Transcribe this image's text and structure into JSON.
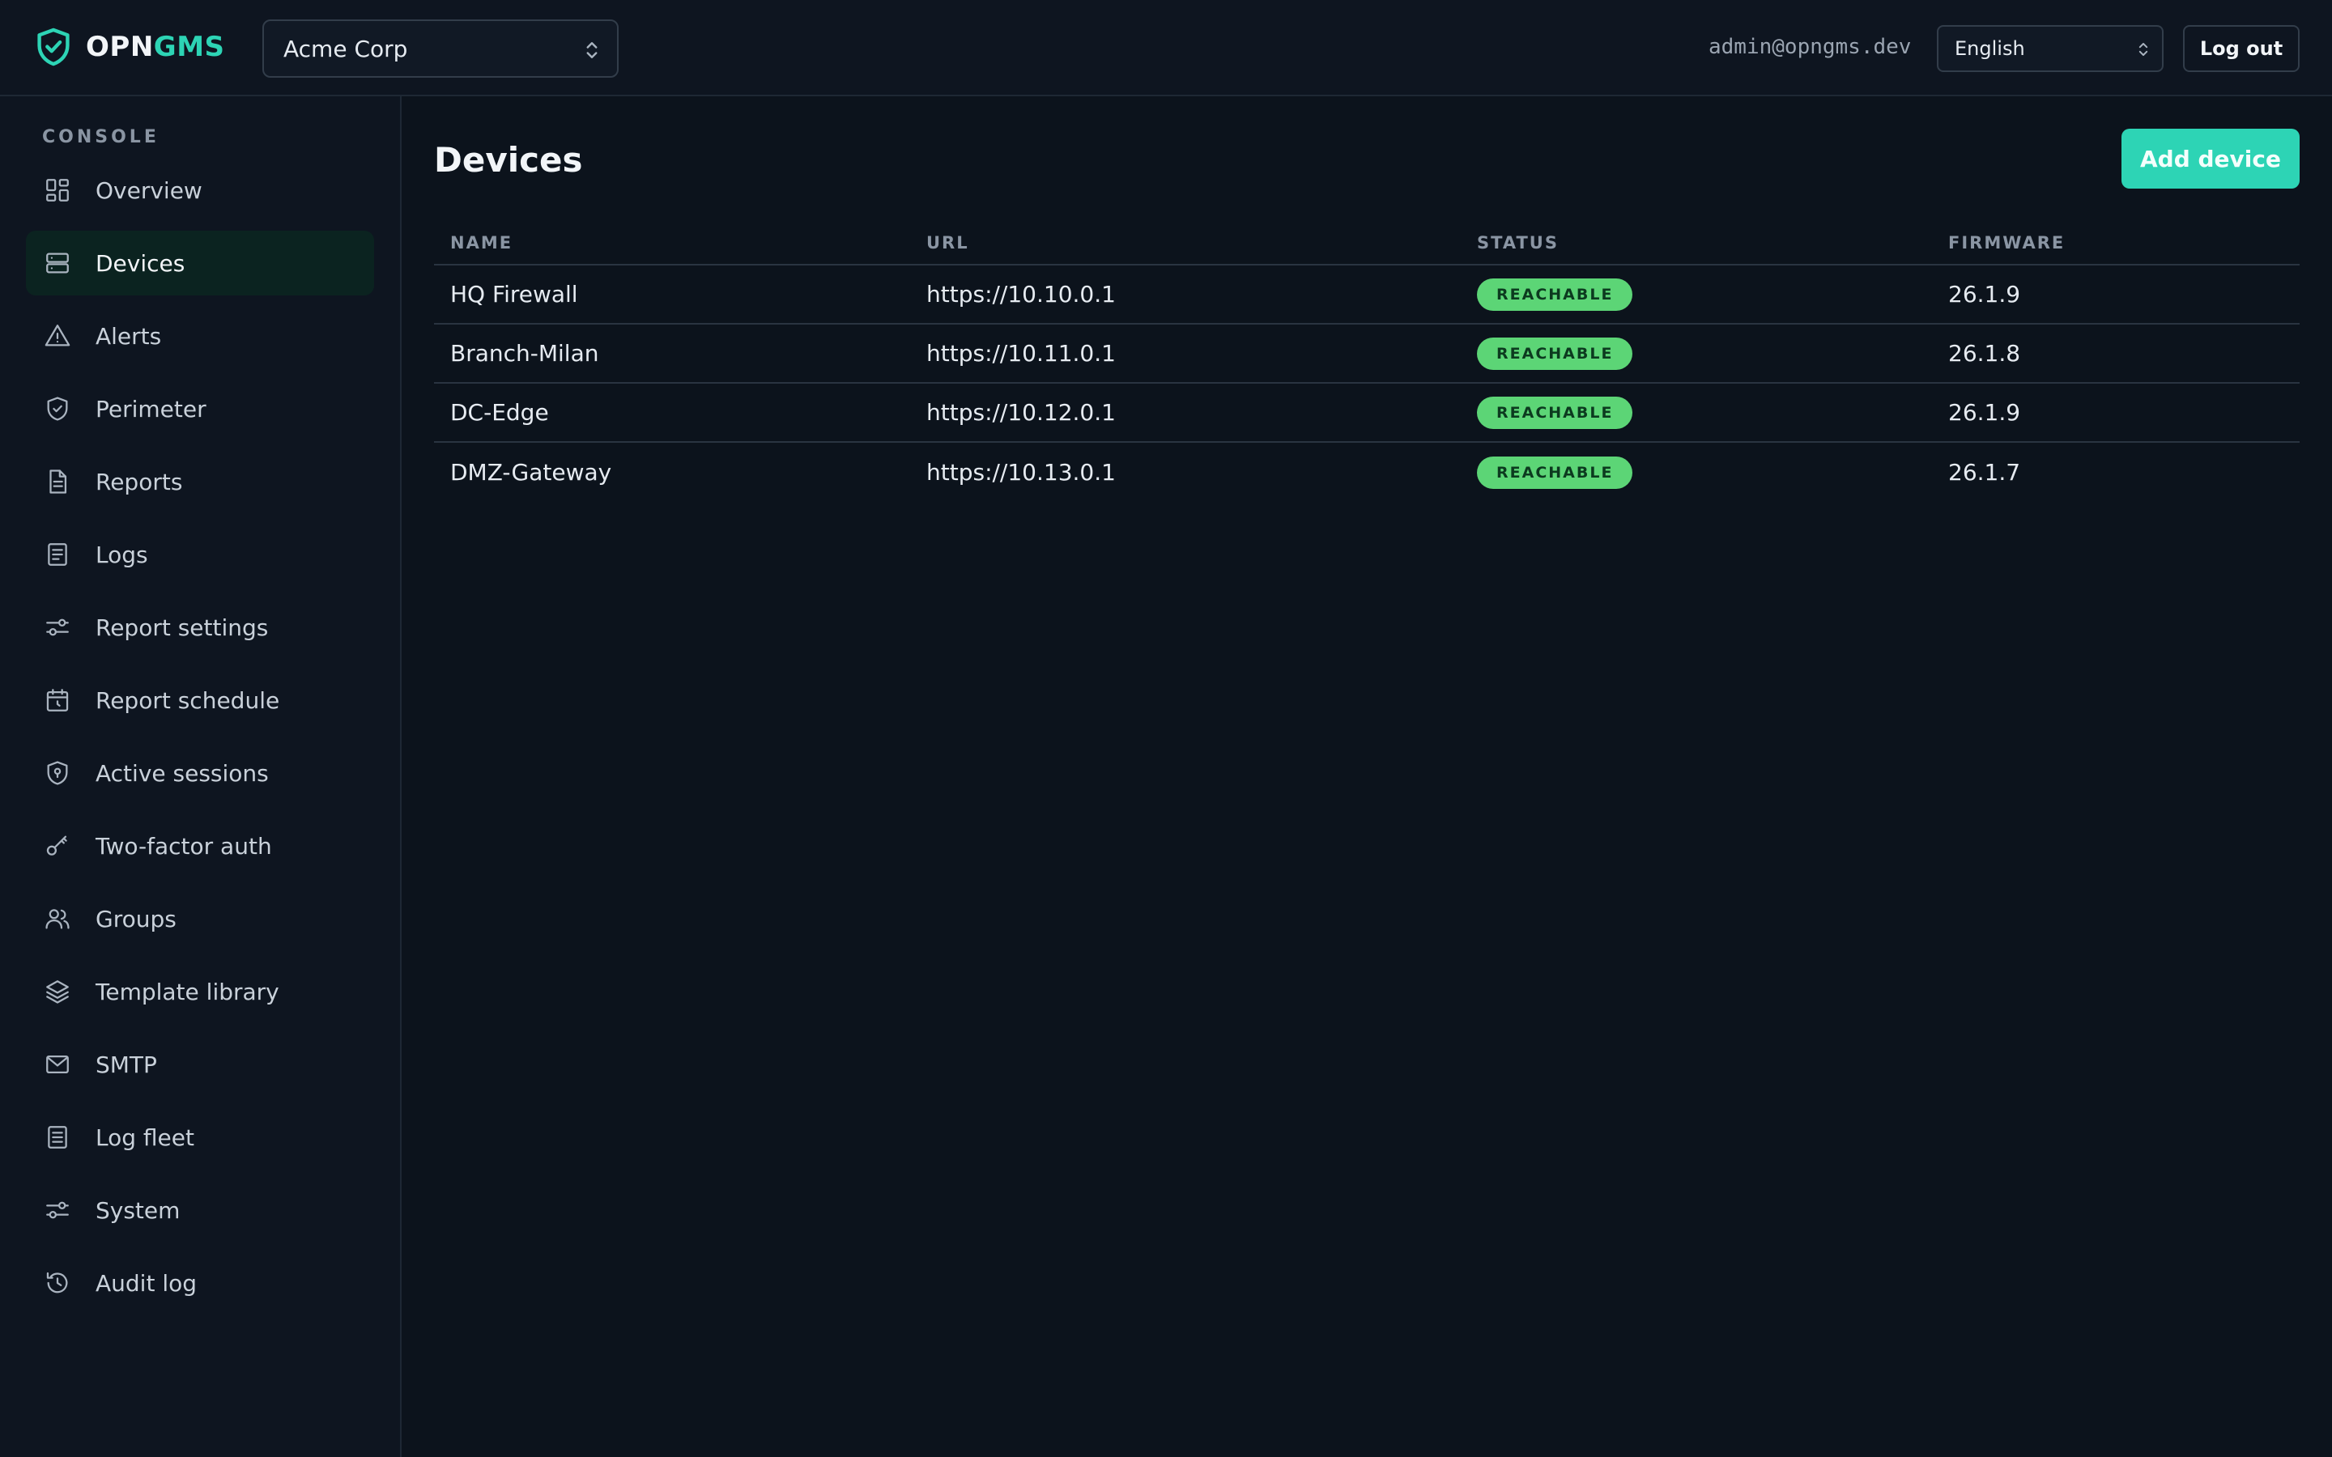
{
  "brand": {
    "name_a": "OPN",
    "name_b": "GMS"
  },
  "header": {
    "org_selected": "Acme Corp",
    "user_email": "admin@opngms.dev",
    "language_selected": "English",
    "logout_label": "Log out"
  },
  "sidebar": {
    "section_label": "CONSOLE",
    "items": [
      {
        "label": "Overview",
        "icon": "grid-icon"
      },
      {
        "label": "Devices",
        "icon": "server-icon",
        "active": true
      },
      {
        "label": "Alerts",
        "icon": "alert-triangle-icon"
      },
      {
        "label": "Perimeter",
        "icon": "shield-check-icon"
      },
      {
        "label": "Reports",
        "icon": "file-text-icon"
      },
      {
        "label": "Logs",
        "icon": "file-lines-icon"
      },
      {
        "label": "Report settings",
        "icon": "sliders-icon"
      },
      {
        "label": "Report schedule",
        "icon": "calendar-clock-icon"
      },
      {
        "label": "Active sessions",
        "icon": "shield-pin-icon"
      },
      {
        "label": "Two-factor auth",
        "icon": "key-icon"
      },
      {
        "label": "Groups",
        "icon": "users-icon"
      },
      {
        "label": "Template library",
        "icon": "layers-icon"
      },
      {
        "label": "SMTP",
        "icon": "mail-icon"
      },
      {
        "label": "Log fleet",
        "icon": "file-list-icon"
      },
      {
        "label": "System",
        "icon": "sliders-icon"
      },
      {
        "label": "Audit log",
        "icon": "history-icon"
      }
    ]
  },
  "main": {
    "title": "Devices",
    "add_label": "Add device",
    "columns": [
      "NAME",
      "URL",
      "STATUS",
      "FIRMWARE"
    ],
    "rows": [
      {
        "name": "HQ Firewall",
        "url": "https://10.10.0.1",
        "status": "REACHABLE",
        "firmware": "26.1.9"
      },
      {
        "name": "Branch-Milan",
        "url": "https://10.11.0.1",
        "status": "REACHABLE",
        "firmware": "26.1.8"
      },
      {
        "name": "DC-Edge",
        "url": "https://10.12.0.1",
        "status": "REACHABLE",
        "firmware": "26.1.9"
      },
      {
        "name": "DMZ-Gateway",
        "url": "https://10.13.0.1",
        "status": "REACHABLE",
        "firmware": "26.1.7"
      }
    ]
  },
  "colors": {
    "accent": "#2dd4b5",
    "status_ok": "#5cd576",
    "background": "#0c131c"
  }
}
